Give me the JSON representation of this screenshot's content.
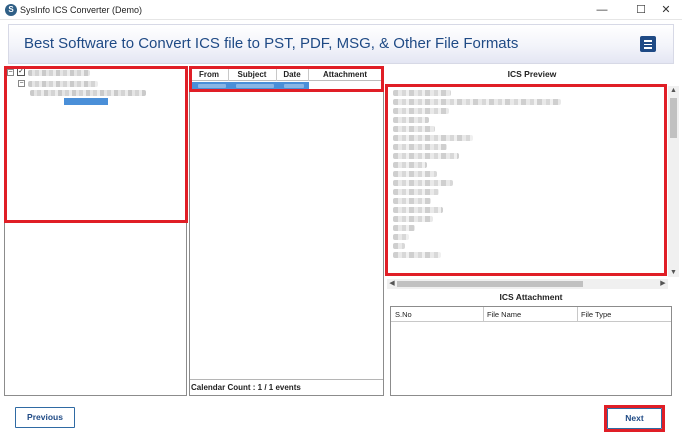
{
  "window": {
    "app_icon_glyph": "S",
    "title": "SysInfo ICS Converter (Demo)",
    "minimize": "—",
    "maximize": "☐",
    "close": "✕"
  },
  "banner": {
    "text": "Best Software to Convert ICS file to PST, PDF, MSG, & Other File Formats"
  },
  "tree": {
    "expander_root": "−",
    "expander_child": "−",
    "checkbox_mark": "✓"
  },
  "events_grid": {
    "columns": [
      "From",
      "Subject",
      "Date",
      "Attachment"
    ],
    "calendar_count": "Calendar Count :  1 / 1 events"
  },
  "preview": {
    "title": "ICS Preview",
    "scroll_up": "▲",
    "scroll_down": "▼",
    "scroll_left": "◀",
    "scroll_right": "▶"
  },
  "attachments": {
    "title": "ICS Attachment",
    "columns": [
      "S.No",
      "File Name",
      "File Type"
    ]
  },
  "footer": {
    "previous_label": "Previous",
    "next_label": "Next"
  },
  "colors": {
    "accent": "#1f4a85",
    "highlight_red": "#e01e26",
    "selection_blue": "#4a8fd8"
  }
}
